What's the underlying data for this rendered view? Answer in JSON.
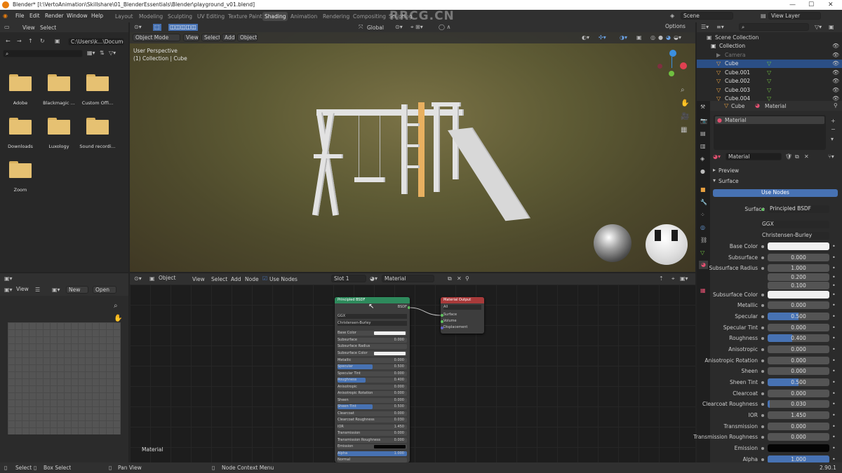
{
  "window": {
    "title": "Blender* [I:\\VertoAnimation\\Skillshare\\01_BlenderEssentials\\Blender\\playground_v01.blend]"
  },
  "menu": [
    "File",
    "Edit",
    "Render",
    "Window",
    "Help"
  ],
  "workspaces": [
    "Layout",
    "Modeling",
    "Sculpting",
    "UV Editing",
    "Texture Paint",
    "Shading",
    "Animation",
    "Rendering",
    "Compositing",
    "Scripting"
  ],
  "active_workspace": "Shading",
  "scene": {
    "label": "Scene",
    "view_layer": "View Layer"
  },
  "file_browser": {
    "header": [
      "View",
      "Select"
    ],
    "path": "C:\\Users\\k...\\Documents\\",
    "folders": [
      "Adobe",
      "Blackmagic ...",
      "Custom Offi...",
      "Downloads",
      "Luxology",
      "Sound recordi...",
      "Zoom"
    ]
  },
  "viewport": {
    "mode": "Object Mode",
    "menus": [
      "View",
      "Select",
      "Add",
      "Object"
    ],
    "orientation": "Global",
    "options": "Options",
    "overlay_title": "User Perspective",
    "overlay_sub": "(1) Collection | Cube"
  },
  "image_editor": {
    "view": "View",
    "new": "New",
    "open": "Open"
  },
  "node_editor": {
    "object": "Object",
    "menus": [
      "View",
      "Select",
      "Add",
      "Node"
    ],
    "use_nodes": "Use Nodes",
    "slot": "Slot 1",
    "material": "Material",
    "footer_label": "Material",
    "bsdf": {
      "title": "Principled BSDF",
      "output": "BSDF",
      "dist": "GGX",
      "sss_method": "Christensen-Burley",
      "rows": [
        {
          "n": "Base Color",
          "v": ""
        },
        {
          "n": "Subsurface",
          "v": "0.000"
        },
        {
          "n": "Subsurface Radius",
          "v": ""
        },
        {
          "n": "Subsurface Color",
          "v": ""
        },
        {
          "n": "Metallic",
          "v": "0.000"
        },
        {
          "n": "Specular",
          "v": "0.500"
        },
        {
          "n": "Specular Tint",
          "v": "0.000"
        },
        {
          "n": "Roughness",
          "v": "0.400"
        },
        {
          "n": "Anisotropic",
          "v": "0.000"
        },
        {
          "n": "Anisotropic Rotation",
          "v": "0.000"
        },
        {
          "n": "Sheen",
          "v": "0.000"
        },
        {
          "n": "Sheen Tint",
          "v": "0.500"
        },
        {
          "n": "Clearcoat",
          "v": "0.000"
        },
        {
          "n": "Clearcoat Roughness",
          "v": "0.030"
        },
        {
          "n": "IOR",
          "v": "1.450"
        },
        {
          "n": "Transmission",
          "v": "0.000"
        },
        {
          "n": "Transmission Roughness",
          "v": "0.000"
        },
        {
          "n": "Emission",
          "v": ""
        },
        {
          "n": "Alpha",
          "v": "1.000"
        },
        {
          "n": "Normal",
          "v": ""
        }
      ]
    },
    "output": {
      "title": "Material Output",
      "target": "All",
      "sockets": [
        "Surface",
        "Volume",
        "Displacement"
      ]
    }
  },
  "outliner": {
    "root": "Scene Collection",
    "items": [
      "Collection",
      "Camera",
      "Cube",
      "Cube.001",
      "Cube.002",
      "Cube.003",
      "Cube.004"
    ],
    "selected": "Cube"
  },
  "properties": {
    "breadcrumb": [
      "Cube",
      "Material"
    ],
    "slot": "Material",
    "material_name": "Material",
    "panels": [
      "Preview",
      "Surface"
    ],
    "use_nodes": "Use Nodes",
    "surface_label": "Surface",
    "surface_value": "Principled BSDF",
    "distribution": "GGX",
    "sss_method": "Christensen-Burley",
    "rows": [
      {
        "n": "Base Color",
        "v": "",
        "type": "color",
        "color": "#f0f0f0"
      },
      {
        "n": "Subsurface",
        "v": "0.000",
        "fill": 0
      },
      {
        "n": "Subsurface Radius",
        "v": "1.000",
        "fill": 0
      },
      {
        "n": "",
        "v": "0.200",
        "fill": 0
      },
      {
        "n": "",
        "v": "0.100",
        "fill": 0
      },
      {
        "n": "Subsurface Color",
        "v": "",
        "type": "color",
        "color": "#f0f0f0"
      },
      {
        "n": "Metallic",
        "v": "0.000",
        "fill": 0
      },
      {
        "n": "Specular",
        "v": "0.500",
        "fill": 0.5
      },
      {
        "n": "Specular Tint",
        "v": "0.000",
        "fill": 0
      },
      {
        "n": "Roughness",
        "v": "0.400",
        "fill": 0.4
      },
      {
        "n": "Anisotropic",
        "v": "0.000",
        "fill": 0
      },
      {
        "n": "Anisotropic Rotation",
        "v": "0.000",
        "fill": 0
      },
      {
        "n": "Sheen",
        "v": "0.000",
        "fill": 0
      },
      {
        "n": "Sheen Tint",
        "v": "0.500",
        "fill": 0.5
      },
      {
        "n": "Clearcoat",
        "v": "0.000",
        "fill": 0
      },
      {
        "n": "Clearcoat Roughness",
        "v": "0.030",
        "fill": 0.03
      },
      {
        "n": "IOR",
        "v": "1.450",
        "fill": 0
      },
      {
        "n": "Transmission",
        "v": "0.000",
        "fill": 0
      },
      {
        "n": "Transmission Roughness",
        "v": "0.000",
        "fill": 0
      },
      {
        "n": "Emission",
        "v": "",
        "type": "color",
        "color": "#050505"
      },
      {
        "n": "Alpha",
        "v": "1.000",
        "fill": 1
      }
    ]
  },
  "statusbar": {
    "select": "Select",
    "box": "Box Select",
    "pan": "Pan View",
    "ctx": "Node Context Menu",
    "version": "2.90.1"
  },
  "watermark": "RRCG.CN",
  "colors": {
    "accent": "#4772b3",
    "selection": "#2b4f86",
    "bsdf_header": "#2e8a5c",
    "output_header": "#a83a3a",
    "socket": "#c7a729"
  }
}
